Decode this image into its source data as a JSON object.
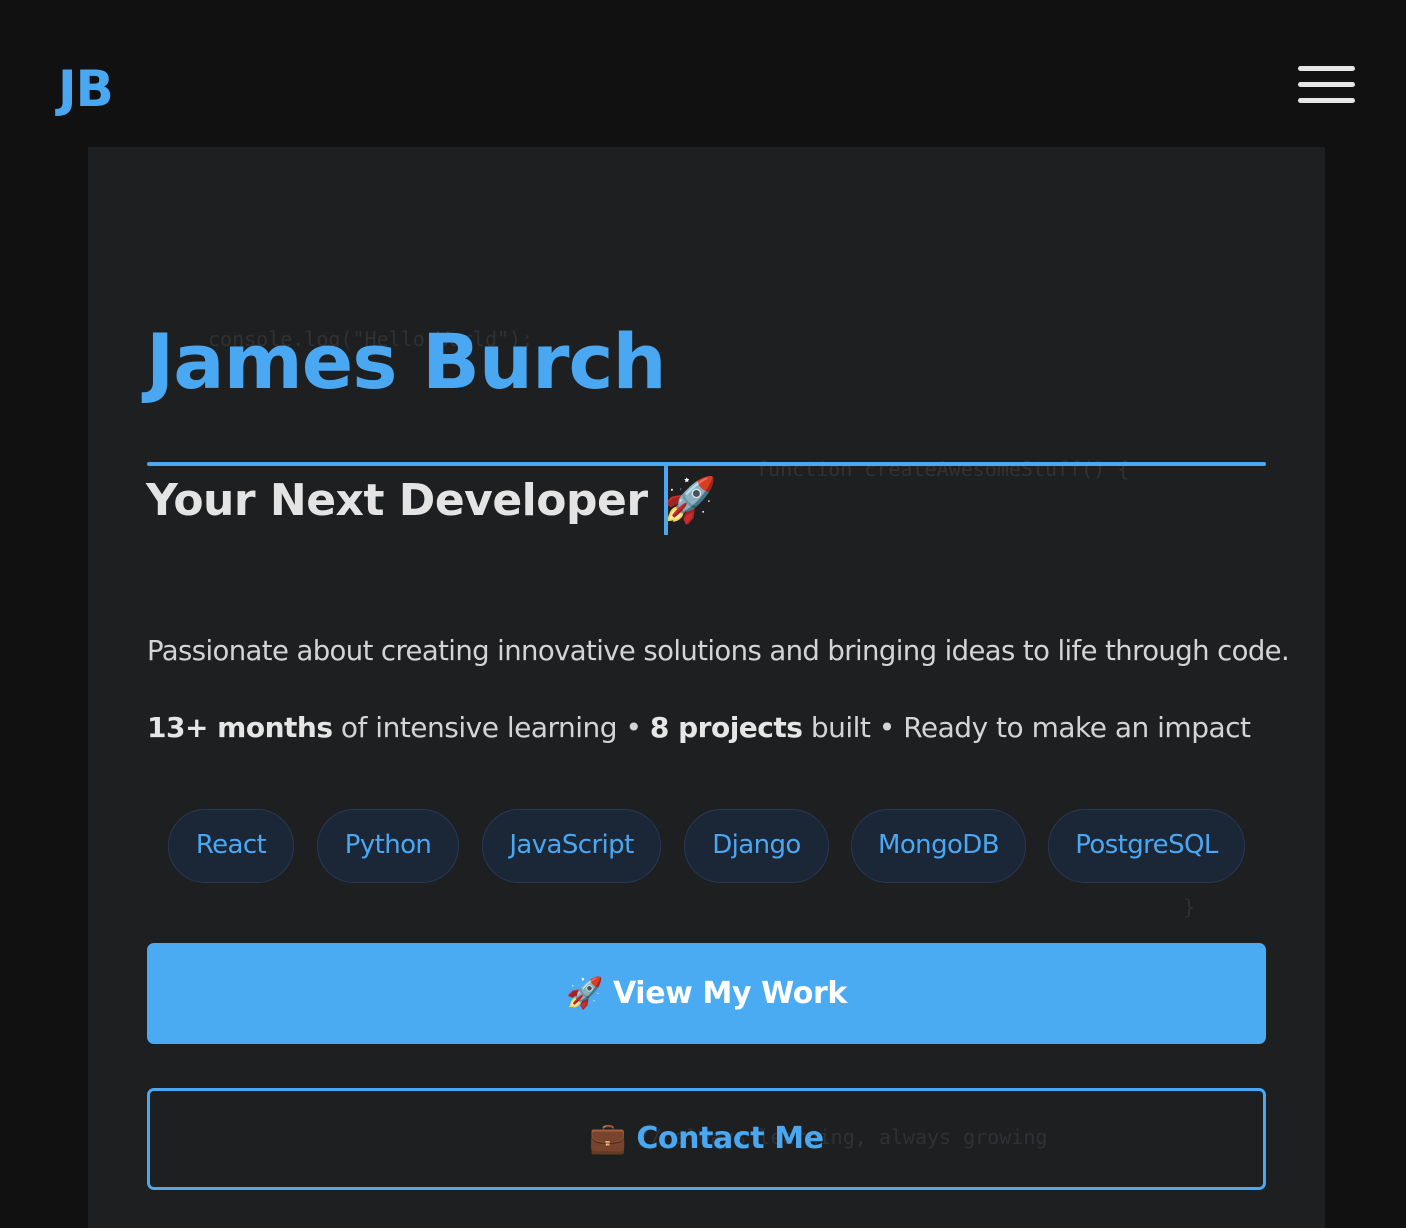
{
  "nav": {
    "logo": "JB",
    "menu_icon": "hamburger-menu-icon"
  },
  "hero": {
    "name": "James Burch",
    "tagline": "Your Next Developer 🚀",
    "bio": "Passionate about creating innovative solutions and bringing ideas to life through code.",
    "stats": {
      "months": "13+ months",
      "months_suffix": " of intensive learning • ",
      "projects": "8 projects",
      "projects_suffix": " built • Ready to make an impact"
    },
    "tech_tags": [
      "React",
      "Python",
      "JavaScript",
      "Django",
      "MongoDB",
      "PostgreSQL"
    ],
    "primary_button": {
      "icon": "🚀",
      "label": "View My Work"
    },
    "secondary_button": {
      "icon": "💼",
      "label": "Contact Me"
    },
    "background_code": [
      "console.log(\"Hello World\");",
      "function createAwesomeStuff() {",
      "}",
      "// always learning, always growing"
    ]
  },
  "colors": {
    "accent": "#4aa8f2",
    "page_background": "#111111",
    "panel_background": "#1e1f20",
    "tag_background": "#1b2637",
    "text": "#d4d4d4"
  }
}
